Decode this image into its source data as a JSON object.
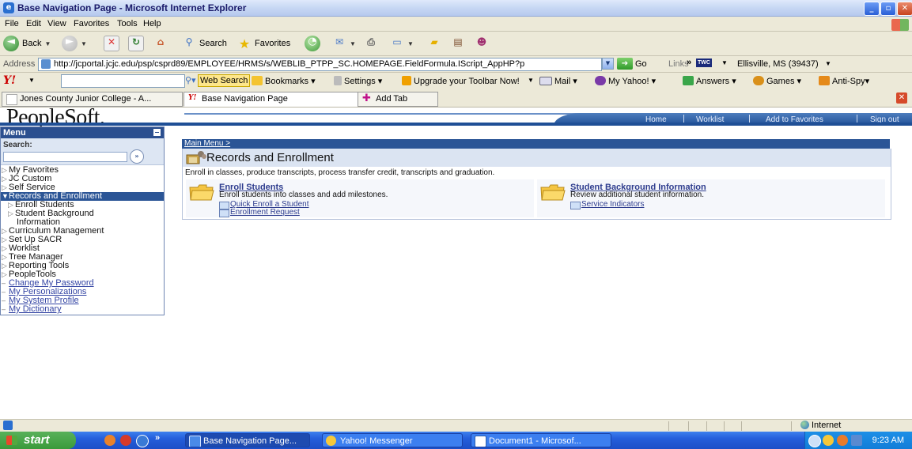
{
  "window": {
    "title": "Base Navigation Page - Microsoft Internet Explorer",
    "buttons": {
      "minimize": "_",
      "maximize": "▫",
      "close": "✕"
    }
  },
  "menubar": [
    "File",
    "Edit",
    "View",
    "Favorites",
    "Tools",
    "Help"
  ],
  "toolbar": {
    "back": "Back",
    "search": "Search",
    "favorites": "Favorites"
  },
  "address": {
    "label": "Address",
    "url": "http://jcportal.jcjc.edu/psp/csprd89/EMPLOYEE/HRMS/s/WEBLIB_PTPP_SC.HOMEPAGE.FieldFormula.IScript_AppHP?p",
    "go": "Go",
    "links": "Links",
    "links_more": "»",
    "weather_badge": "TWC",
    "weather_location": "Ellisville, MS (39437)"
  },
  "yahoo_toolbar": {
    "logo": "Y!",
    "web_search": "Web Search",
    "bookmarks": "Bookmarks",
    "settings": "Settings",
    "upgrade": "Upgrade your Toolbar Now!",
    "mail": "Mail",
    "my_yahoo": "My Yahoo!",
    "answers": "Answers",
    "games": "Games",
    "antispy": "Anti-Spy"
  },
  "tabs": [
    {
      "label": "Jones County Junior College - A...",
      "active": false
    },
    {
      "label": "Base Navigation Page",
      "active": true
    }
  ],
  "add_tab": "Add Tab",
  "peoplesoft": {
    "logo": "PeopleSoft.",
    "header_links": [
      "Home",
      "Worklist",
      "Add to Favorites",
      "Sign out"
    ]
  },
  "menu": {
    "title": "Menu",
    "search_label": "Search:",
    "search_go": "»",
    "items": [
      {
        "label": "My Favorites",
        "type": "folder"
      },
      {
        "label": "JC Custom",
        "type": "folder"
      },
      {
        "label": "Self Service",
        "type": "folder"
      },
      {
        "label": "Records and Enrollment",
        "type": "selected"
      },
      {
        "label": "Enroll Students",
        "type": "sub"
      },
      {
        "label": "Student Background",
        "type": "sub"
      },
      {
        "label": "Information",
        "type": "sub2"
      },
      {
        "label": "Curriculum Management",
        "type": "folder"
      },
      {
        "label": "Set Up SACR",
        "type": "folder"
      },
      {
        "label": "Worklist",
        "type": "folder"
      },
      {
        "label": "Tree Manager",
        "type": "folder"
      },
      {
        "label": "Reporting Tools",
        "type": "folder"
      },
      {
        "label": "PeopleTools",
        "type": "folder"
      },
      {
        "label": "Change My Password",
        "type": "link"
      },
      {
        "label": "My Personalizations",
        "type": "link"
      },
      {
        "label": "My System Profile",
        "type": "link"
      },
      {
        "label": "My Dictionary",
        "type": "link"
      }
    ]
  },
  "content": {
    "breadcrumb": "Main Menu >",
    "title": "Records and Enrollment",
    "description": "Enroll in classes, produce transcripts, process transfer credit, transcripts and graduation.",
    "sections": [
      {
        "title": "Enroll Students",
        "description": "Enroll students into classes and add milestones.",
        "links": [
          "Quick Enroll a Student",
          "Enrollment Request"
        ]
      },
      {
        "title": "Student Background Information",
        "description": "Review additional student information.",
        "links": [
          "Service Indicators"
        ]
      }
    ]
  },
  "status": {
    "zone": "Internet"
  },
  "taskbar": {
    "start": "start",
    "quicklaunch_more": "»",
    "buttons": [
      {
        "label": "Base Navigation Page...",
        "active": true
      },
      {
        "label": "Yahoo! Messenger",
        "active": false
      },
      {
        "label": "Document1 - Microsof...",
        "active": false
      }
    ],
    "clock": "9:23 AM"
  },
  "colors": {
    "ps_blue": "#2b5596",
    "link_blue": "#2d3c8e",
    "xp_taskbar": "#245edb",
    "start_green": "#3a9a3b"
  }
}
